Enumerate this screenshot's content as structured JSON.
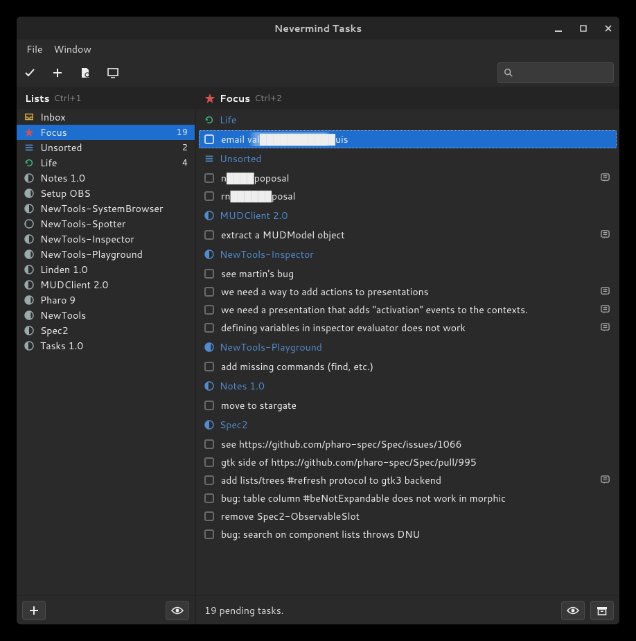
{
  "window": {
    "title": "Nevermind Tasks"
  },
  "menu": {
    "file": "File",
    "window": "Window"
  },
  "search": {
    "placeholder": ""
  },
  "left": {
    "header": {
      "title": "Lists",
      "shortcut": "Ctrl+1"
    }
  },
  "right": {
    "header": {
      "title": "Focus",
      "shortcut": "Ctrl+2"
    }
  },
  "lists": [
    {
      "name": "Inbox",
      "icon": "inbox",
      "count": ""
    },
    {
      "name": "Focus",
      "icon": "star",
      "count": "19",
      "selected": true
    },
    {
      "name": "Unsorted",
      "icon": "queue",
      "count": "2"
    },
    {
      "name": "Life",
      "icon": "refresh",
      "count": "4",
      "accent": "green"
    },
    {
      "name": "Notes 1.0",
      "icon": "moon-40",
      "count": ""
    },
    {
      "name": "Setup OBS",
      "icon": "moon-70",
      "count": ""
    },
    {
      "name": "NewTools-SystemBrowser",
      "icon": "moon-50",
      "count": ""
    },
    {
      "name": "NewTools-Spotter",
      "icon": "moon-10",
      "count": ""
    },
    {
      "name": "NewTools-Inspector",
      "icon": "moon-50",
      "count": ""
    },
    {
      "name": "NewTools-Playground",
      "icon": "moon-70",
      "count": ""
    },
    {
      "name": "Linden 1.0",
      "icon": "moon-40",
      "count": ""
    },
    {
      "name": "MUDClient 2.0",
      "icon": "moon-40",
      "count": ""
    },
    {
      "name": "Pharo 9",
      "icon": "moon-70",
      "count": ""
    },
    {
      "name": "NewTools",
      "icon": "moon-70",
      "count": ""
    },
    {
      "name": "Spec2",
      "icon": "moon-50",
      "count": ""
    },
    {
      "name": "Tasks 1.0",
      "icon": "moon-40",
      "count": ""
    }
  ],
  "sections": [
    {
      "name": "Life",
      "icon": "refresh",
      "tasks": [
        {
          "label": "email val███████████uis",
          "selected": true
        }
      ]
    },
    {
      "name": "Unsorted",
      "icon": "queue",
      "tasks": [
        {
          "label": "n████poposal",
          "notes": true
        },
        {
          "label": "rn██████posal"
        }
      ]
    },
    {
      "name": "MUDClient 2.0",
      "icon": "moon-40",
      "tasks": [
        {
          "label": "extract a MUDModel object",
          "notes": true
        }
      ]
    },
    {
      "name": "NewTools-Inspector",
      "icon": "moon-50",
      "tasks": [
        {
          "label": "see martin's bug"
        },
        {
          "label": "we need a way to add actions to presentations",
          "notes": true
        },
        {
          "label": "we need a presentation that adds \"activation\" events to the contexts.",
          "notes": true
        },
        {
          "label": "defining variables in inspector evaluator does not work",
          "notes": true
        }
      ]
    },
    {
      "name": "NewTools-Playground",
      "icon": "moon-70",
      "tasks": [
        {
          "label": "add missing commands (find, etc.)"
        }
      ]
    },
    {
      "name": "Notes 1.0",
      "icon": "moon-40",
      "tasks": [
        {
          "label": "move to stargate"
        }
      ]
    },
    {
      "name": "Spec2",
      "icon": "moon-50",
      "tasks": [
        {
          "label": "see https://github.com/pharo-spec/Spec/issues/1066"
        },
        {
          "label": "gtk side of https://github.com/pharo-spec/Spec/pull/995"
        },
        {
          "label": "add lists/trees #refresh protocol to gtk3 backend",
          "notes": true
        },
        {
          "label": "bug: table column #beNotExpandable does not work in morphic"
        },
        {
          "label": "remove Spec2-ObservableSlot"
        },
        {
          "label": "bug: search on component lists throws DNU"
        }
      ]
    }
  ],
  "status": "19 pending tasks."
}
